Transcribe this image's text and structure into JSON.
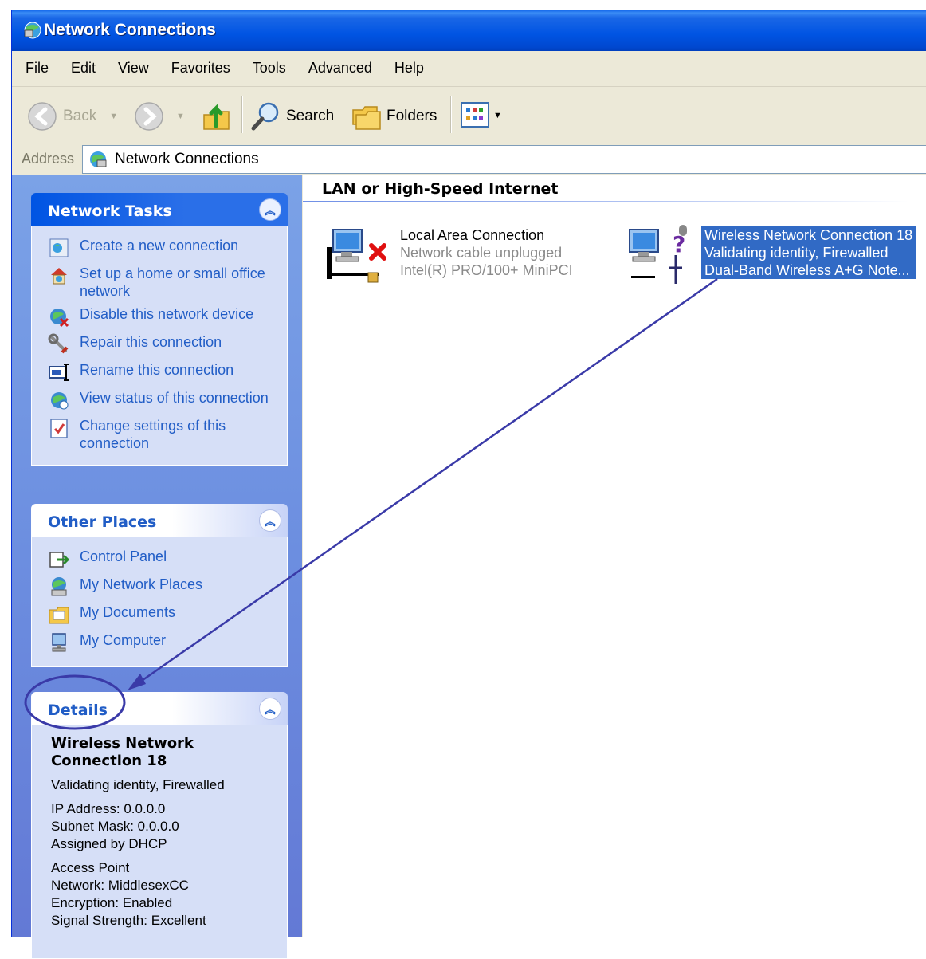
{
  "window": {
    "title": "Network Connections"
  },
  "menu": [
    "File",
    "Edit",
    "View",
    "Favorites",
    "Tools",
    "Advanced",
    "Help"
  ],
  "toolbar": {
    "back": "Back",
    "search": "Search",
    "folders": "Folders"
  },
  "address": {
    "label": "Address",
    "value": "Network Connections"
  },
  "network_tasks": {
    "title": "Network Tasks",
    "items": [
      {
        "label": "Create a new connection",
        "icon": "new-connection-icon"
      },
      {
        "label": "Set up a home or small office network",
        "icon": "home-network-icon"
      },
      {
        "label": "Disable this network device",
        "icon": "disable-device-icon"
      },
      {
        "label": "Repair this connection",
        "icon": "repair-icon"
      },
      {
        "label": "Rename this connection",
        "icon": "rename-icon"
      },
      {
        "label": "View status of this connection",
        "icon": "status-icon"
      },
      {
        "label": "Change settings of this connection",
        "icon": "settings-icon"
      }
    ]
  },
  "other_places": {
    "title": "Other Places",
    "items": [
      {
        "label": "Control Panel",
        "icon": "control-panel-icon"
      },
      {
        "label": "My Network Places",
        "icon": "network-places-icon"
      },
      {
        "label": "My Documents",
        "icon": "documents-folder-icon"
      },
      {
        "label": "My Computer",
        "icon": "computer-icon"
      }
    ]
  },
  "details": {
    "title": "Details",
    "name": "Wireless Network Connection 18",
    "status": "Validating identity, Firewalled",
    "ip": "IP Address: 0.0.0.0",
    "subnet": "Subnet Mask: 0.0.0.0",
    "assigned": "Assigned by DHCP",
    "ap": "Access Point",
    "network": "Network: MiddlesexCC",
    "encryption": "Encryption: Enabled",
    "signal": "Signal Strength: Excellent"
  },
  "content": {
    "group_title": "LAN or High-Speed Internet",
    "connections": [
      {
        "name": "Local Area Connection",
        "status": "Network cable unplugged",
        "device": "Intel(R) PRO/100+ MiniPCI",
        "selected": false
      },
      {
        "name": "Wireless Network Connection 18",
        "status": "Validating identity, Firewalled",
        "device": "Dual-Band Wireless A+G Note...",
        "selected": true
      }
    ]
  },
  "colors": {
    "title_bar": "#0054e3",
    "link": "#215dc6",
    "selection": "#316ac5",
    "annotation": "#3a3aa8"
  }
}
